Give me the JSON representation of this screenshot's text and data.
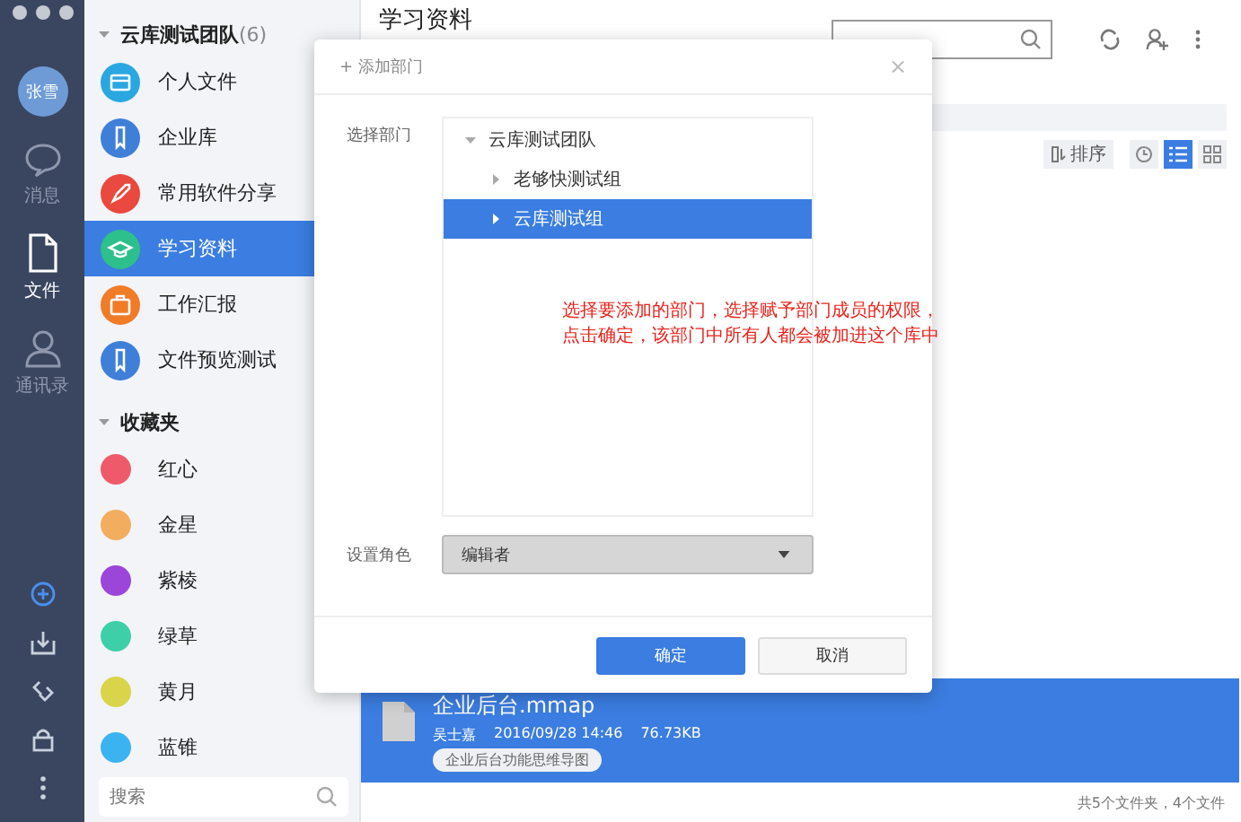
{
  "nav": {
    "user": {
      "initials": "张雪"
    },
    "items": [
      {
        "label": "消息",
        "kind": "chat",
        "selected": false
      },
      {
        "label": "文件",
        "kind": "file",
        "selected": true
      },
      {
        "label": "通讯录",
        "kind": "person",
        "selected": false
      }
    ]
  },
  "sidebar": {
    "team": {
      "name": "云库测试团队",
      "count": "(6)",
      "expanded": true,
      "items": [
        {
          "label": "个人文件",
          "kind": "box",
          "color": "#2aa7e0",
          "selected": false
        },
        {
          "label": "企业库",
          "kind": "bookmark",
          "color": "#3f7fd8",
          "selected": false
        },
        {
          "label": "常用软件分享",
          "kind": "rocket",
          "color": "#e9493f",
          "selected": false
        },
        {
          "label": "学习资料",
          "kind": "cap",
          "color": "#2dbf8c",
          "selected": true
        },
        {
          "label": "工作汇报",
          "kind": "bag",
          "color": "#f07c28",
          "selected": false
        },
        {
          "label": "文件预览测试",
          "kind": "bookmark",
          "color": "#3f7fd8",
          "selected": false
        }
      ]
    },
    "favorites": {
      "title": "收藏夹",
      "expanded": true,
      "items": [
        {
          "label": "红心",
          "color": "#ef5a6a"
        },
        {
          "label": "金星",
          "color": "#f3ad5e"
        },
        {
          "label": "紫棱",
          "color": "#9b46d8"
        },
        {
          "label": "绿草",
          "color": "#3ecfa8"
        },
        {
          "label": "黄月",
          "color": "#d9d44a"
        },
        {
          "label": "蓝锥",
          "color": "#3bb3f0"
        }
      ]
    },
    "search": {
      "placeholder": "搜索"
    }
  },
  "main": {
    "title": "学习资料",
    "sort_label": "排序",
    "views": [
      {
        "kind": "recent",
        "selected": false
      },
      {
        "kind": "list",
        "selected": true
      },
      {
        "kind": "grid",
        "selected": false
      }
    ],
    "files": [
      {
        "name": "企业后台.mmap",
        "owner": "吴士嘉",
        "date": "2016/09/28 14:46",
        "size": "76.73KB",
        "tag": "企业后台功能思维导图",
        "selected": true
      }
    ],
    "status_bar": "共5个文件夹，4个文件"
  },
  "dialog": {
    "title": "+ 添加部门",
    "close": "×",
    "department_label": "选择部门",
    "tree": [
      {
        "label": "云库测试团队",
        "expanded": true,
        "selected": false,
        "children": [
          {
            "label": "老够快测试组",
            "expanded": false,
            "selected": false
          },
          {
            "label": "云库测试组",
            "expanded": false,
            "selected": true
          }
        ]
      }
    ],
    "annotation": [
      "选择要添加的部门，选择赋予部门成员的权限，",
      "点击确定，该部门中所有人都会被加进这个库中"
    ],
    "role_label": "设置角色",
    "role": {
      "value": "编辑者"
    },
    "buttons": [
      {
        "label": "确定",
        "kind": "primary"
      },
      {
        "label": "取消",
        "kind": "secondary"
      }
    ]
  }
}
